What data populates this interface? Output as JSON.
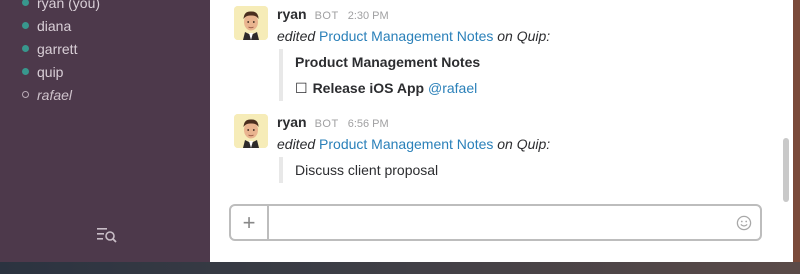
{
  "sidebar": {
    "direct_messages": [
      {
        "name": "ryan (you)",
        "presence": "online"
      },
      {
        "name": "diana",
        "presence": "online"
      },
      {
        "name": "garrett",
        "presence": "online"
      },
      {
        "name": "quip",
        "presence": "online"
      },
      {
        "name": "rafael",
        "presence": "away"
      }
    ],
    "footer_icon": "search-list-icon"
  },
  "messages": [
    {
      "sender": "ryan",
      "tag": "BOT",
      "time": "2:30 PM",
      "action_prefix": "edited",
      "doc_link": "Product Management Notes",
      "action_suffix": "on Quip:",
      "quote_title": "Product Management Notes",
      "checkbox": "☐",
      "task": "Release iOS App",
      "mention": "@rafael"
    },
    {
      "sender": "ryan",
      "tag": "BOT",
      "time": "6:56 PM",
      "action_prefix": "edited",
      "doc_link": "Product Management Notes",
      "action_suffix": "on Quip:",
      "quote_text": "Discuss client proposal"
    }
  ],
  "composer": {
    "plus_label": "+",
    "placeholder": "",
    "emoji_icon": "smiley-icon"
  },
  "colors": {
    "sidebar_bg": "#4d394b",
    "presence_online": "#38978d",
    "link": "#2a80b9"
  }
}
